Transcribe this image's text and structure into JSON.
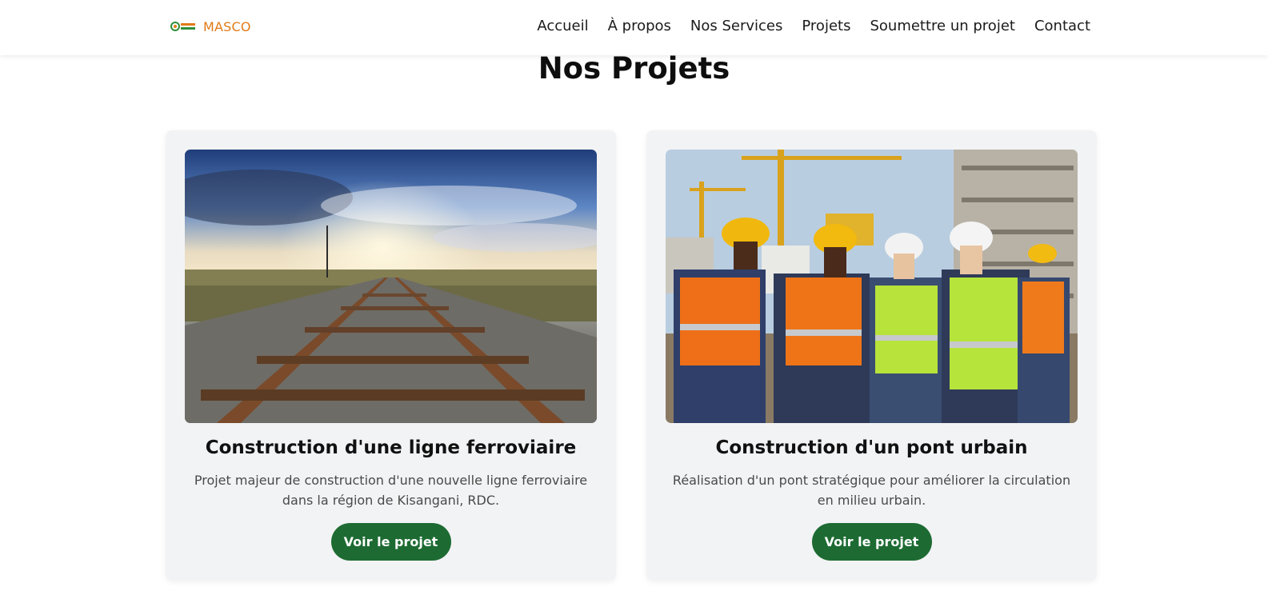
{
  "brand": {
    "name": "MASCO",
    "logo_icon": "masco-logo-icon",
    "color": "#e07b17"
  },
  "nav": {
    "items": [
      "Accueil",
      "À propos",
      "Nos Services",
      "Projets",
      "Soumettre un projet",
      "Contact"
    ]
  },
  "section": {
    "title": "Nos Projets"
  },
  "projects": [
    {
      "image_icon": "railway-tracks-image",
      "title": "Construction d'une ligne ferroviaire",
      "description": "Projet majeur de construction d'une nouvelle ligne ferroviaire dans la région de Kisangani, RDC.",
      "button_label": "Voir le projet"
    },
    {
      "image_icon": "construction-workers-image",
      "title": "Construction d'un pont urbain",
      "description": "Réalisation d'un pont stratégique pour améliorer la circulation en milieu urbain.",
      "button_label": "Voir le projet"
    }
  ],
  "colors": {
    "button": "#1d6b32",
    "card_bg": "#f2f3f5",
    "accent": "#e07b17"
  }
}
